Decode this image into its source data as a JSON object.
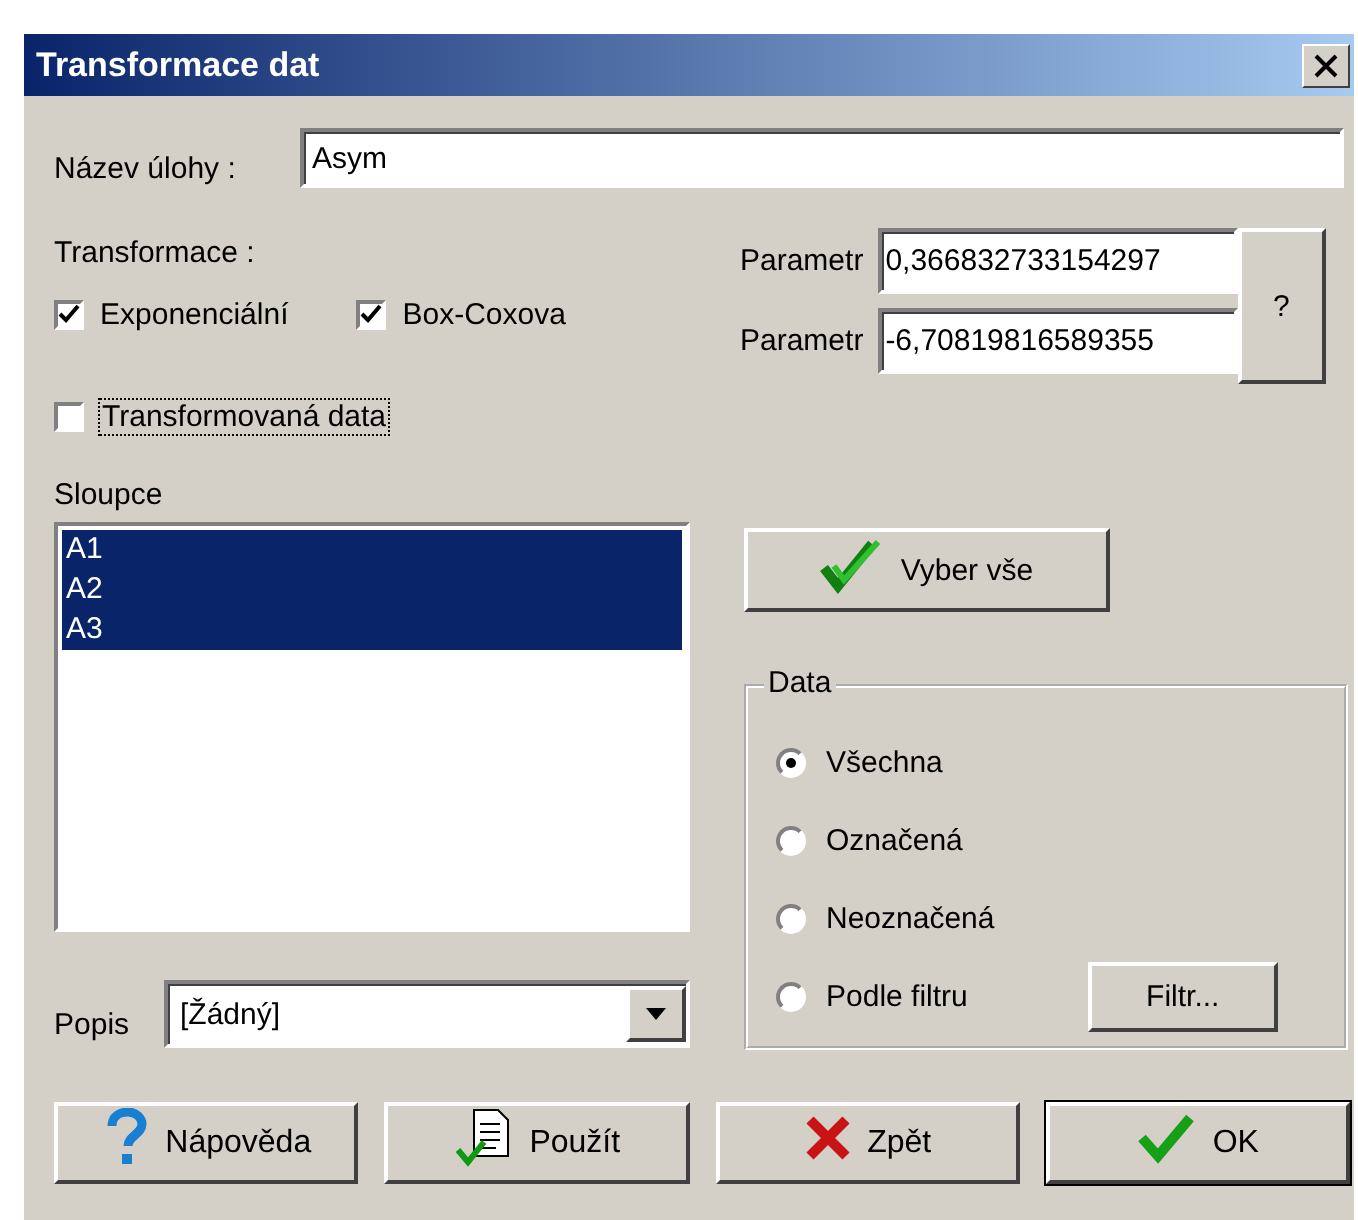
{
  "window": {
    "title": "Transformace dat"
  },
  "task_name": {
    "label": "Název úlohy :",
    "value": "Asym"
  },
  "transformations": {
    "label": "Transformace :",
    "options": [
      {
        "label": "Exponenciální",
        "checked": true
      },
      {
        "label": "Box-Coxova",
        "checked": true
      }
    ]
  },
  "parameters": [
    {
      "label": "Parametr",
      "value": "0,366832733154297"
    },
    {
      "label": "Parametr",
      "value": "-6,70819816589355"
    }
  ],
  "help_button": "?",
  "transformed_data": {
    "label": "Transformovaná data",
    "checked": false,
    "focused": true
  },
  "columns": {
    "label": "Sloupce",
    "items": [
      {
        "label": "A1",
        "selected": true
      },
      {
        "label": "A2",
        "selected": true
      },
      {
        "label": "A3",
        "selected": true
      }
    ]
  },
  "select_all_button": "Vyber vše",
  "data_group": {
    "title": "Data",
    "options": [
      {
        "label": "Všechna",
        "selected": true
      },
      {
        "label": "Označená",
        "selected": false
      },
      {
        "label": "Neoznačená",
        "selected": false
      },
      {
        "label": "Podle filtru",
        "selected": false
      }
    ]
  },
  "filter_button": "Filtr...",
  "description": {
    "label": "Popis",
    "value": "[Žádný]"
  },
  "buttons": [
    {
      "label": "Nápověda",
      "kind": "help",
      "default": false
    },
    {
      "label": "Použít",
      "kind": "apply",
      "default": false
    },
    {
      "label": "Zpět",
      "kind": "cancel",
      "default": false
    },
    {
      "label": "OK",
      "kind": "ok",
      "default": true
    }
  ]
}
